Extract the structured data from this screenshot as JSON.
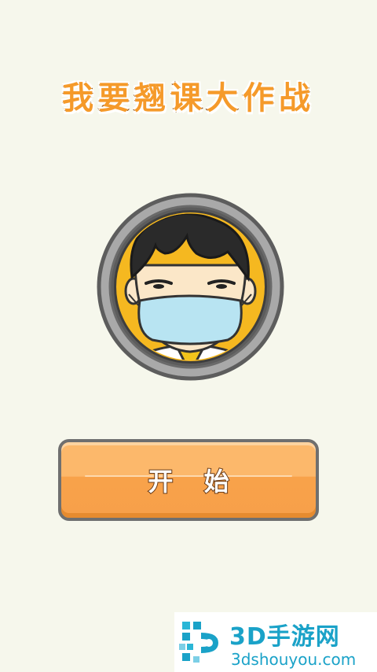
{
  "game": {
    "title": "我要翘课大作战",
    "start_label": "开 始"
  },
  "watermark": {
    "name": "3D手游网",
    "url": "3dshouyou.com"
  },
  "colors": {
    "background": "#f6f7ec",
    "title_orange": "#f59a2a",
    "button_orange": "#f8a24a",
    "avatar_ring_yellow": "#f5b820",
    "mask_blue": "#b8e4f2",
    "watermark_blue": "#1aa2c8"
  },
  "icons": {
    "avatar": "masked-student-avatar",
    "logo": "3dshouyou-logo-icon"
  }
}
